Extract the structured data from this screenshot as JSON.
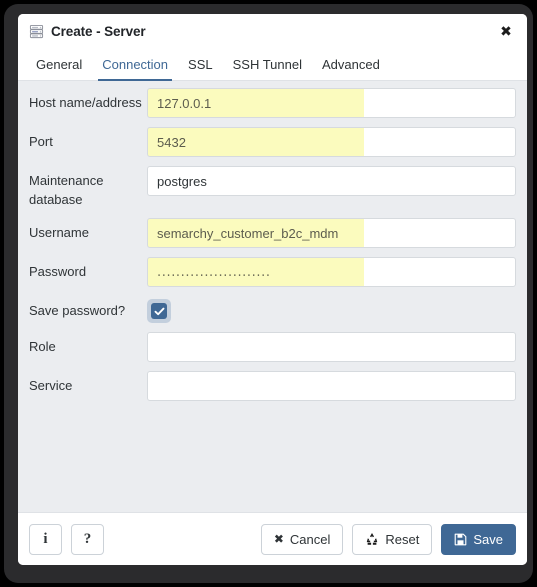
{
  "window": {
    "title": "Create - Server",
    "icon": "server-rack-icon",
    "close_label": "✖"
  },
  "tabs": [
    {
      "label": "General",
      "active": false
    },
    {
      "label": "Connection",
      "active": true
    },
    {
      "label": "SSL",
      "active": false
    },
    {
      "label": "SSH Tunnel",
      "active": false
    },
    {
      "label": "Advanced",
      "active": false
    }
  ],
  "form": {
    "host": {
      "label": "Host name/address",
      "value": "127.0.0.1",
      "placeholder": "",
      "autofilled": true
    },
    "port": {
      "label": "Port",
      "value": "5432",
      "placeholder": "",
      "autofilled": true
    },
    "maintenance_db": {
      "label": "Maintenance database",
      "value": "postgres",
      "placeholder": "",
      "autofilled": false
    },
    "username": {
      "label": "Username",
      "value": "semarchy_customer_b2c_mdm",
      "placeholder": "",
      "autofilled": true
    },
    "password": {
      "label": "Password",
      "value": "........................",
      "placeholder": "",
      "autofilled": true
    },
    "save_password": {
      "label": "Save password?",
      "checked": true
    },
    "role": {
      "label": "Role",
      "value": "",
      "placeholder": "",
      "autofilled": false
    },
    "service": {
      "label": "Service",
      "value": "",
      "placeholder": "",
      "autofilled": false
    }
  },
  "footer": {
    "info_label": "i",
    "help_label": "?",
    "cancel_label": "Cancel",
    "reset_label": "Reset",
    "save_label": "Save"
  },
  "colors": {
    "accent": "#3f6895",
    "autofill_yellow": "#fbfbbe",
    "body_background": "#ebedf0",
    "frame": "#2b2b2d"
  }
}
